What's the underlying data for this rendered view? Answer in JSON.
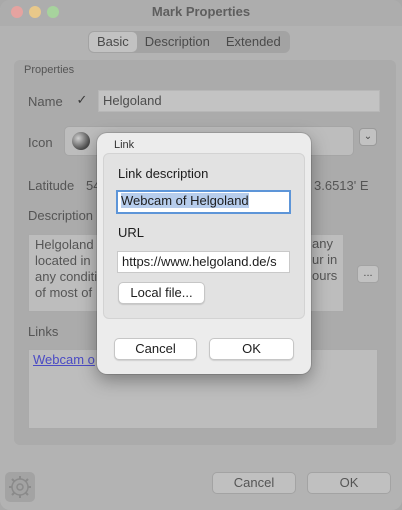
{
  "window": {
    "title": "Mark Properties",
    "tabs": [
      {
        "label": "Basic",
        "active": true
      },
      {
        "label": "Description",
        "active": false
      },
      {
        "label": "Extended",
        "active": false
      }
    ]
  },
  "properties": {
    "section_label": "Properties",
    "name_label": "Name",
    "name_value": "Helgoland",
    "name_checked": true,
    "icon_label": "Icon",
    "latitude_label": "Latitude",
    "latitude_value_partial": "54",
    "longitude_value_partial": "3.6513' E",
    "description_label": "Description",
    "description_lines": [
      "Helgoland",
      "located in",
      "any conditi",
      "of most of"
    ],
    "description_right_lines": [
      "any",
      "ur in",
      "ours",
      ""
    ],
    "more_button_label": "...",
    "links_label": "Links",
    "links": [
      "Webcam o"
    ]
  },
  "footer": {
    "cancel_label": "Cancel",
    "ok_label": "OK"
  },
  "link_dialog": {
    "title": "Link",
    "description_label": "Link description",
    "description_value": "Webcam of Helgoland",
    "url_label": "URL",
    "url_value": "https://www.helgoland.de/s",
    "local_file_label": "Local file...",
    "cancel_label": "Cancel",
    "ok_label": "OK"
  }
}
